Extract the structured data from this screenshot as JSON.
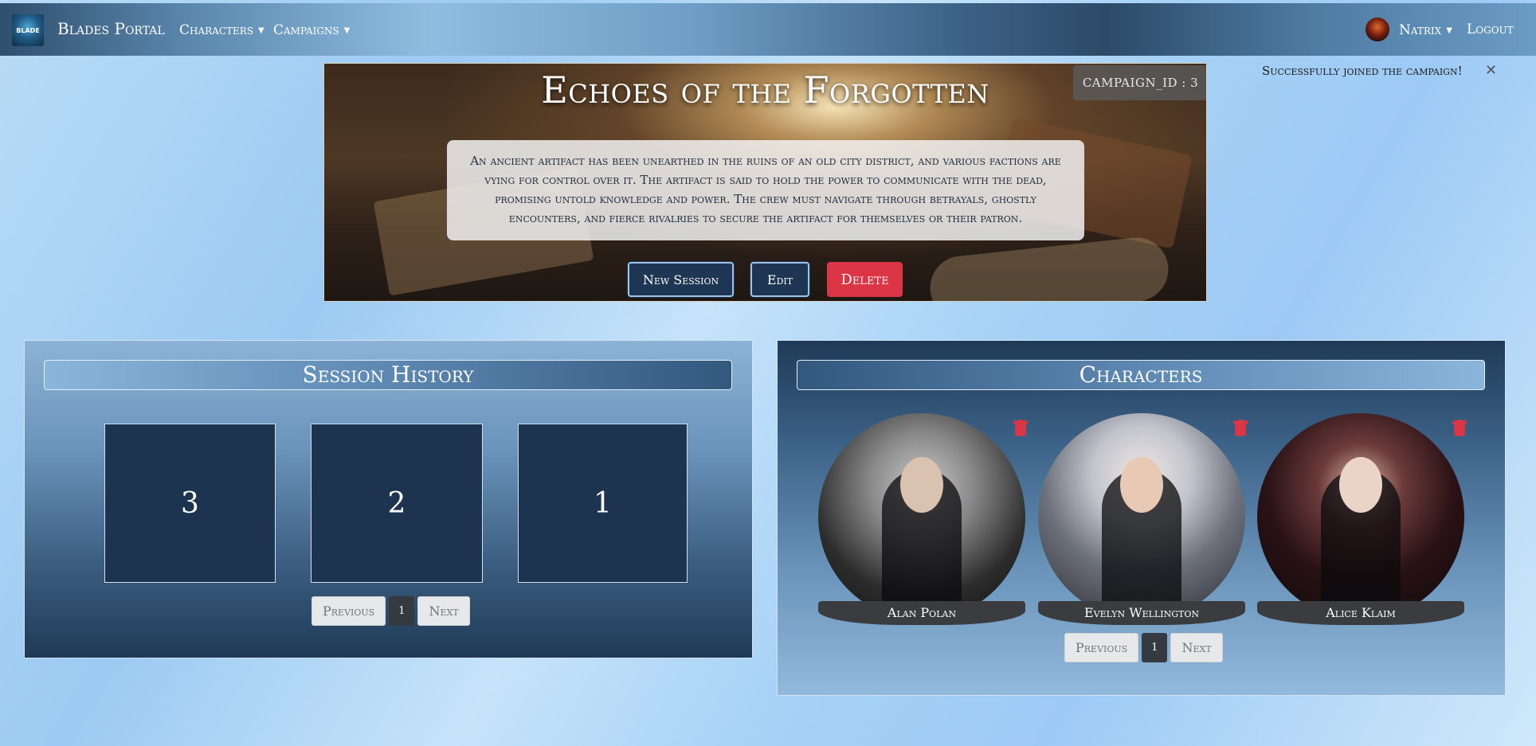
{
  "navbar": {
    "brand_logo_text": "BLADE",
    "brand": "Blades Portal",
    "menus": [
      {
        "label": "Characters"
      },
      {
        "label": "Campaigns"
      }
    ],
    "user": "Natrix",
    "logout": "Logout"
  },
  "campaign": {
    "title": "Echoes of the Forgotten",
    "id_badge": "CAMPAIGN_ID : 3",
    "description": "An ancient artifact has been unearthed in the ruins of an old city district, and various factions are vying for control over it. The artifact is said to hold the power to communicate with the dead, promising untold knowledge and power. The crew must navigate through betrayals, ghostly encounters, and fierce rivalries to secure the artifact for themselves or their patron.",
    "buttons": {
      "new_session": "New Session",
      "edit": "Edit",
      "delete": "Delete"
    }
  },
  "toast": {
    "message": "Successfully joined the campaign!",
    "close": "✕"
  },
  "session_history": {
    "title": "Session History",
    "sessions": [
      {
        "number": "3"
      },
      {
        "number": "2"
      },
      {
        "number": "1"
      }
    ],
    "pagination": {
      "previous": "Previous",
      "page": "1",
      "next": "Next"
    }
  },
  "characters": {
    "title": "Characters",
    "list": [
      {
        "name": "Alan Polan"
      },
      {
        "name": "Evelyn Wellington"
      },
      {
        "name": "Alice Klaim"
      }
    ],
    "pagination": {
      "previous": "Previous",
      "page": "1",
      "next": "Next"
    }
  },
  "colors": {
    "danger": "#dc3545",
    "navy": "#1d3451",
    "pagination_active": "#343a40"
  },
  "icons": [
    "caret-down-icon",
    "trash-icon",
    "close-icon",
    "avatar"
  ]
}
